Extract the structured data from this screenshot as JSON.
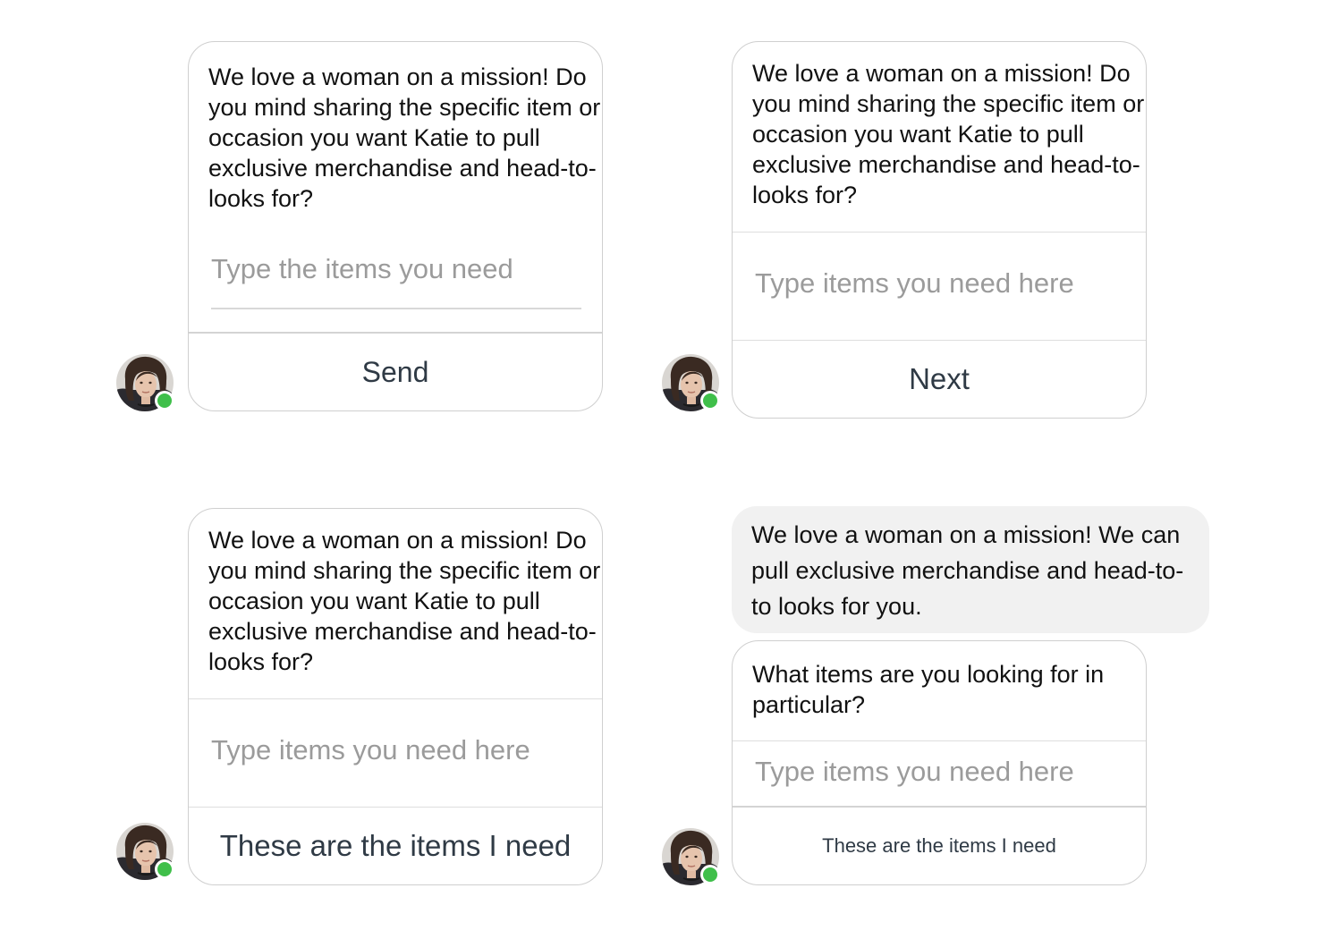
{
  "variant_a": {
    "message": "We love a woman on a mission! Do you mind sharing the specific item or occasion you want Katie to pull exclusive merchandise and head-to-looks for?",
    "placeholder": "Type the items you need",
    "action_label": "Send"
  },
  "variant_b": {
    "message": "We love a woman on a mission! Do you mind sharing the specific item or occasion you want Katie to pull exclusive merchandise and head-to-looks for?",
    "placeholder": "Type items you need here",
    "action_label": "Next"
  },
  "variant_c": {
    "message": "We love a woman on a mission! Do you mind sharing the specific item or occasion you want Katie to pull exclusive merchandise and head-to-looks for?",
    "placeholder": "Type items you need here",
    "action_label": "These are the items I need"
  },
  "variant_d": {
    "intro_message": "We love a woman on a mission! We can pull exclusive merchandise and head-to-to looks for you.",
    "question": "What items are you looking for in particular?",
    "placeholder": "Type items you need here",
    "action_label": "These are the items I need"
  },
  "avatar": {
    "status": "online",
    "status_color": "#3fbf4a"
  },
  "icons": {
    "avatar": "agent-avatar",
    "status": "online-status-dot"
  }
}
